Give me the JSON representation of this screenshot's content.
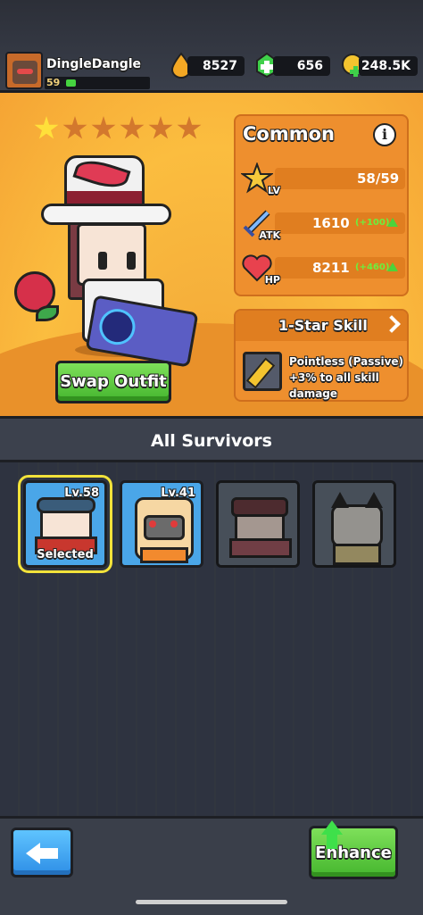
{
  "player": {
    "name": "DingleDangle",
    "level": "59",
    "xp_fraction": 0.12
  },
  "resources": [
    {
      "name": "fuel",
      "icon": "fuel-drop-icon",
      "value": "8527",
      "color": "#f4a824"
    },
    {
      "name": "gems",
      "icon": "green-gem-icon",
      "value": "656",
      "color": "#3fd04a"
    },
    {
      "name": "coins",
      "icon": "gold-coin-icon",
      "value": "248.5K",
      "color": "#f4c42f"
    }
  ],
  "character": {
    "stars_total": 6,
    "stars_filled": 1,
    "rarity": "Common",
    "stats": [
      {
        "label": "LV",
        "icon": "star-level-icon",
        "value": "58/59",
        "bonus": ""
      },
      {
        "label": "ATK",
        "icon": "sword-icon",
        "value": "1610",
        "bonus": "(+100)"
      },
      {
        "label": "HP",
        "icon": "heart-icon",
        "value": "8211",
        "bonus": "(+460)"
      }
    ],
    "skill": {
      "title": "1-Star Skill",
      "description": "Pointless (Passive) +3% to all skill damage"
    },
    "swap_label": "Swap Outfit"
  },
  "survivors": {
    "title": "All Survivors",
    "cards": [
      {
        "level": "Lv.58",
        "status": "Selected",
        "locked": false,
        "bg": "#4aa6e8"
      },
      {
        "level": "Lv.41",
        "status": "",
        "locked": false,
        "bg": "#4aa6e8"
      },
      {
        "level": "",
        "status": "",
        "locked": true,
        "bg": "#556b84"
      },
      {
        "level": "",
        "status": "",
        "locked": true,
        "bg": "#556b84"
      }
    ]
  },
  "bottom": {
    "enhance_label": "Enhance"
  }
}
